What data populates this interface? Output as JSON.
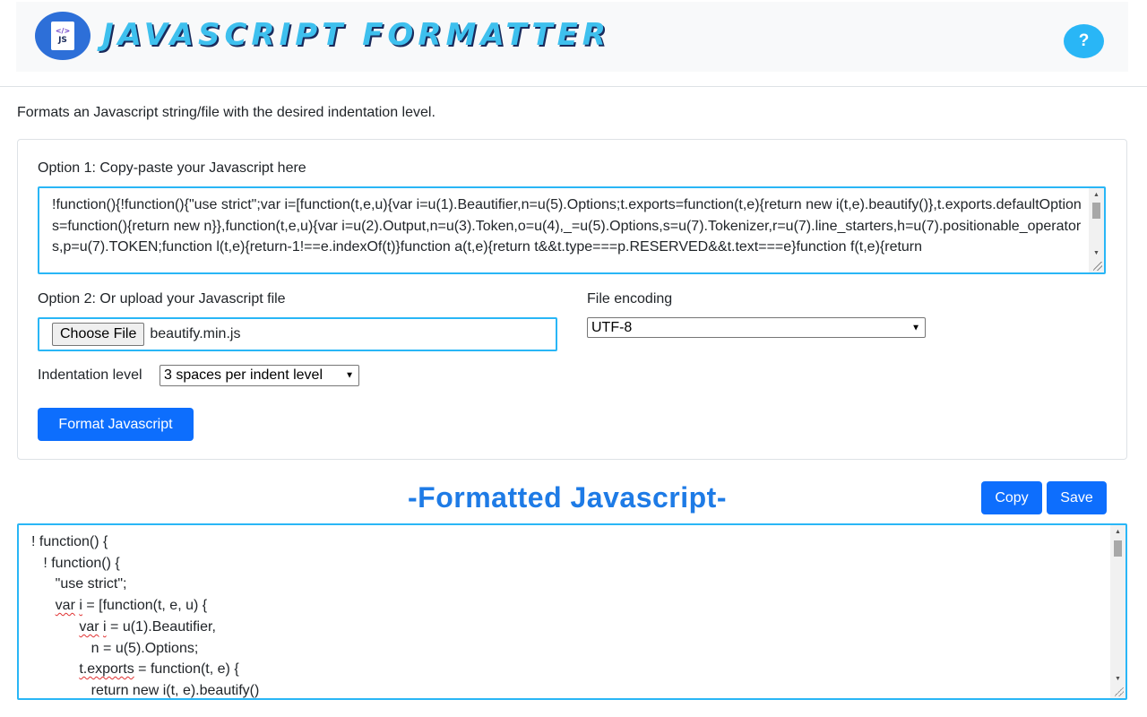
{
  "header": {
    "logo": {
      "code_glyph": "</>",
      "badge_text": "JS"
    },
    "title": "JAVASCRIPT FORMATTER",
    "help_label": "?"
  },
  "description": "Formats an Javascript string/file with the desired indentation level.",
  "option1": {
    "label": "Option 1: Copy-paste your Javascript here",
    "value": "!function(){!function(){\"use strict\";var i=[function(t,e,u){var i=u(1).Beautifier,n=u(5).Options;t.exports=function(t,e){return new i(t,e).beautify()},t.exports.defaultOptions=function(){return new n}},function(t,e,u){var i=u(2).Output,n=u(3).Token,o=u(4),_=u(5).Options,s=u(7).Tokenizer,r=u(7).line_starters,h=u(7).positionable_operators,p=u(7).TOKEN;function l(t,e){return-1!==e.indexOf(t)}function a(t,e){return t&&t.type===p.RESERVED&&t.text===e}function f(t,e){return"
  },
  "option2": {
    "label": "Option 2: Or upload your Javascript file",
    "choose_file_label": "Choose File",
    "file_name": "beautify.min.js"
  },
  "encoding": {
    "label": "File encoding",
    "selected": "UTF-8"
  },
  "indentation": {
    "label": "Indentation level",
    "selected": "3 spaces per indent level"
  },
  "format_button": "Format Javascript",
  "output": {
    "title": "-Formatted Javascript-",
    "copy_label": "Copy",
    "save_label": "Save",
    "lines": [
      "! function() {",
      "   ! function() {",
      "      \"use strict\";",
      "      var i = [function(t, e, u) {",
      "            var i = u(1).Beautifier,",
      "               n = u(5).Options;",
      "            t.exports = function(t, e) {",
      "               return new i(t, e).beautify()"
    ]
  },
  "colors": {
    "accent": "#29b6f6",
    "primary_button": "#0d6efd",
    "output_title": "#1e7be6",
    "spellcheck_underline": "#e03131"
  }
}
